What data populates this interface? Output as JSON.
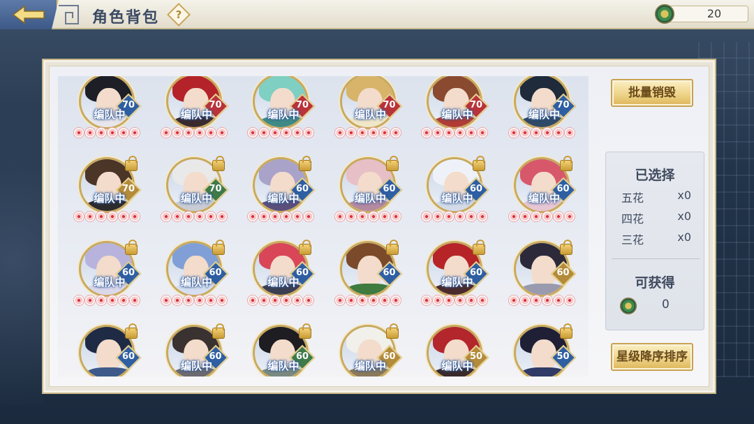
{
  "header": {
    "title": "角色背包",
    "help_icon": "question-icon",
    "help_symbol": "?",
    "currency_icon": "jade-coin-icon",
    "currency_amount": "20"
  },
  "actions": {
    "batch_destroy_label": "批量销毁",
    "sort_label": "星级降序排序"
  },
  "summary": {
    "title": "已选择",
    "rows": [
      {
        "label": "五花",
        "value": "x0"
      },
      {
        "label": "四花",
        "value": "x0"
      },
      {
        "label": "三花",
        "value": "x0"
      }
    ],
    "obtain_title": "可获得",
    "obtain_icon": "jade-coin-icon",
    "obtain_value": "0"
  },
  "characters": [
    {
      "level": "70",
      "tag": "编队中",
      "locked": false,
      "badge": "#2f5fa3",
      "hair": "#1e1e26",
      "body": "#e8e6ea"
    },
    {
      "level": "70",
      "tag": "编队中",
      "locked": false,
      "badge": "#b9333a",
      "hair": "#b5232a",
      "body": "#3a2a2e"
    },
    {
      "level": "70",
      "tag": "编队中",
      "locked": false,
      "badge": "#b9333a",
      "hair": "#7fcfc2",
      "body": "#3f8a85"
    },
    {
      "level": "70",
      "tag": "编队中",
      "locked": false,
      "badge": "#b9333a",
      "hair": "#d7b46a",
      "body": "#f0e6c8"
    },
    {
      "level": "70",
      "tag": "编队中",
      "locked": false,
      "badge": "#b9333a",
      "hair": "#8a4a30",
      "body": "#b03c35"
    },
    {
      "level": "70",
      "tag": "编队中",
      "locked": false,
      "badge": "#2f5fa3",
      "hair": "#1f2a3a",
      "body": "#2f4a66"
    },
    {
      "level": "70",
      "tag": "编队中",
      "locked": true,
      "badge": "#b38b3a",
      "hair": "#4a3527",
      "body": "#2d2b2c"
    },
    {
      "level": "70",
      "tag": "编队中",
      "locked": true,
      "badge": "#3e7a4a",
      "hair": "#e9e9ea",
      "body": "#c9ccd4"
    },
    {
      "level": "60",
      "tag": "编队中",
      "locked": true,
      "badge": "#2f5fa3",
      "hair": "#a9a2c9",
      "body": "#5a4f7a"
    },
    {
      "level": "60",
      "tag": "编队中",
      "locked": true,
      "badge": "#2f5fa3",
      "hair": "#e7bfc6",
      "body": "#b48aa0"
    },
    {
      "level": "60",
      "tag": "编队中",
      "locked": true,
      "badge": "#2f5fa3",
      "hair": "#eef2f8",
      "body": "#d3dbe8"
    },
    {
      "level": "60",
      "tag": "编队中",
      "locked": true,
      "badge": "#2f5fa3",
      "hair": "#d8586b",
      "body": "#e6c6d2"
    },
    {
      "level": "60",
      "tag": "编队中",
      "locked": true,
      "badge": "#2f5fa3",
      "hair": "#b7b3dc",
      "body": "#dcd8ec"
    },
    {
      "level": "60",
      "tag": "编队中",
      "locked": true,
      "badge": "#2f5fa3",
      "hair": "#7f9fd6",
      "body": "#d7e0f2"
    },
    {
      "level": "60",
      "tag": "编队中",
      "locked": true,
      "badge": "#2f5fa3",
      "hair": "#d94657",
      "body": "#3b3f52"
    },
    {
      "level": "60",
      "tag": "",
      "locked": true,
      "badge": "#2f5fa3",
      "hair": "#7a4a2a",
      "body": "#3f7a3f"
    },
    {
      "level": "60",
      "tag": "编队中",
      "locked": true,
      "badge": "#2f5fa3",
      "hair": "#b62428",
      "body": "#4a2a2a"
    },
    {
      "level": "60",
      "tag": "",
      "locked": true,
      "badge": "#b38b3a",
      "hair": "#2c2a3a",
      "body": "#9a9aae"
    },
    {
      "level": "60",
      "tag": "",
      "locked": true,
      "badge": "#2f5fa3",
      "hair": "#1f2a44",
      "body": "#3d5a8a"
    },
    {
      "level": "60",
      "tag": "编队中",
      "locked": true,
      "badge": "#2f5fa3",
      "hair": "#3a3230",
      "body": "#6b6a70"
    },
    {
      "level": "60",
      "tag": "编队中",
      "locked": true,
      "badge": "#3e7a4a",
      "hair": "#1d1d22",
      "body": "#7a8a80"
    },
    {
      "level": "60",
      "tag": "编队中",
      "locked": true,
      "badge": "#b38b3a",
      "hair": "#f1f0ea",
      "body": "#8a7a5a"
    },
    {
      "level": "50",
      "tag": "编队中",
      "locked": false,
      "badge": "#b38b3a",
      "hair": "#b2262c",
      "body": "#3a2a2a"
    },
    {
      "level": "50",
      "tag": "",
      "locked": true,
      "badge": "#2f5fa3",
      "hair": "#1f1f35",
      "body": "#2f3a66"
    }
  ]
}
